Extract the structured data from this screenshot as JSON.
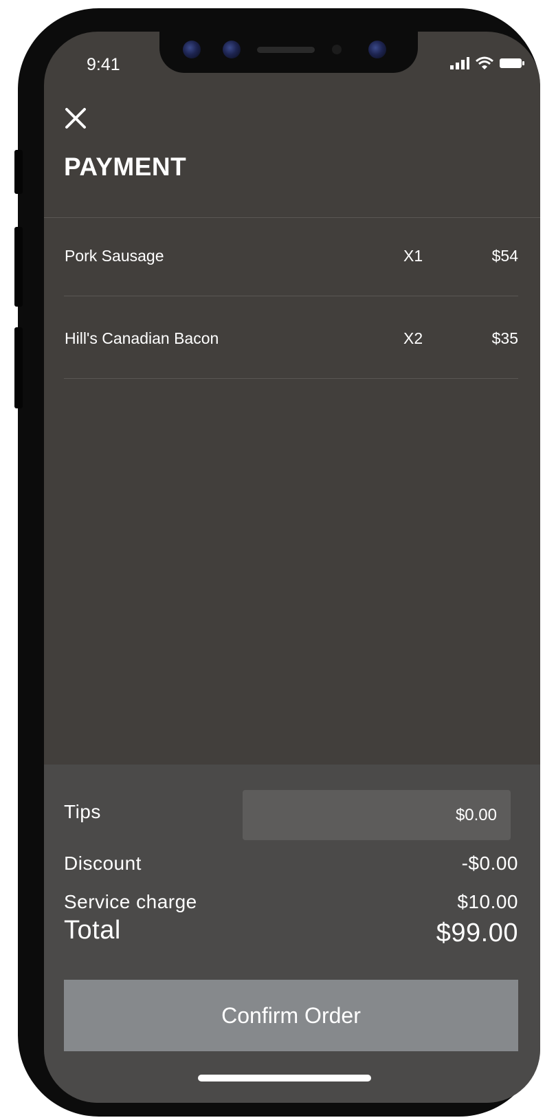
{
  "status_bar": {
    "time": "9:41",
    "icons": [
      "signal-icon",
      "wifi-icon",
      "battery-icon"
    ]
  },
  "header": {
    "close_icon": "close-icon",
    "title": "PAYMENT"
  },
  "order_items": [
    {
      "name": "Pork Sausage",
      "quantity": "X1",
      "price": "$54"
    },
    {
      "name": "Hill's Canadian Bacon",
      "quantity": "X2",
      "price": "$35"
    }
  ],
  "summary": {
    "tips_label": "Tips",
    "tips_value": "$0.00",
    "discount_label": "Discount",
    "discount_value": "-$0.00",
    "service_label": "Service charge",
    "service_value": "$10.00",
    "total_label": "Total",
    "total_value": "$99.00"
  },
  "actions": {
    "confirm_label": "Confirm Order"
  },
  "colors": {
    "screen_background": "#423f3c",
    "summary_background": "#4b4a49",
    "input_background": "#5d5c5b",
    "confirm_button": "#86898c",
    "text": "#ffffff"
  }
}
